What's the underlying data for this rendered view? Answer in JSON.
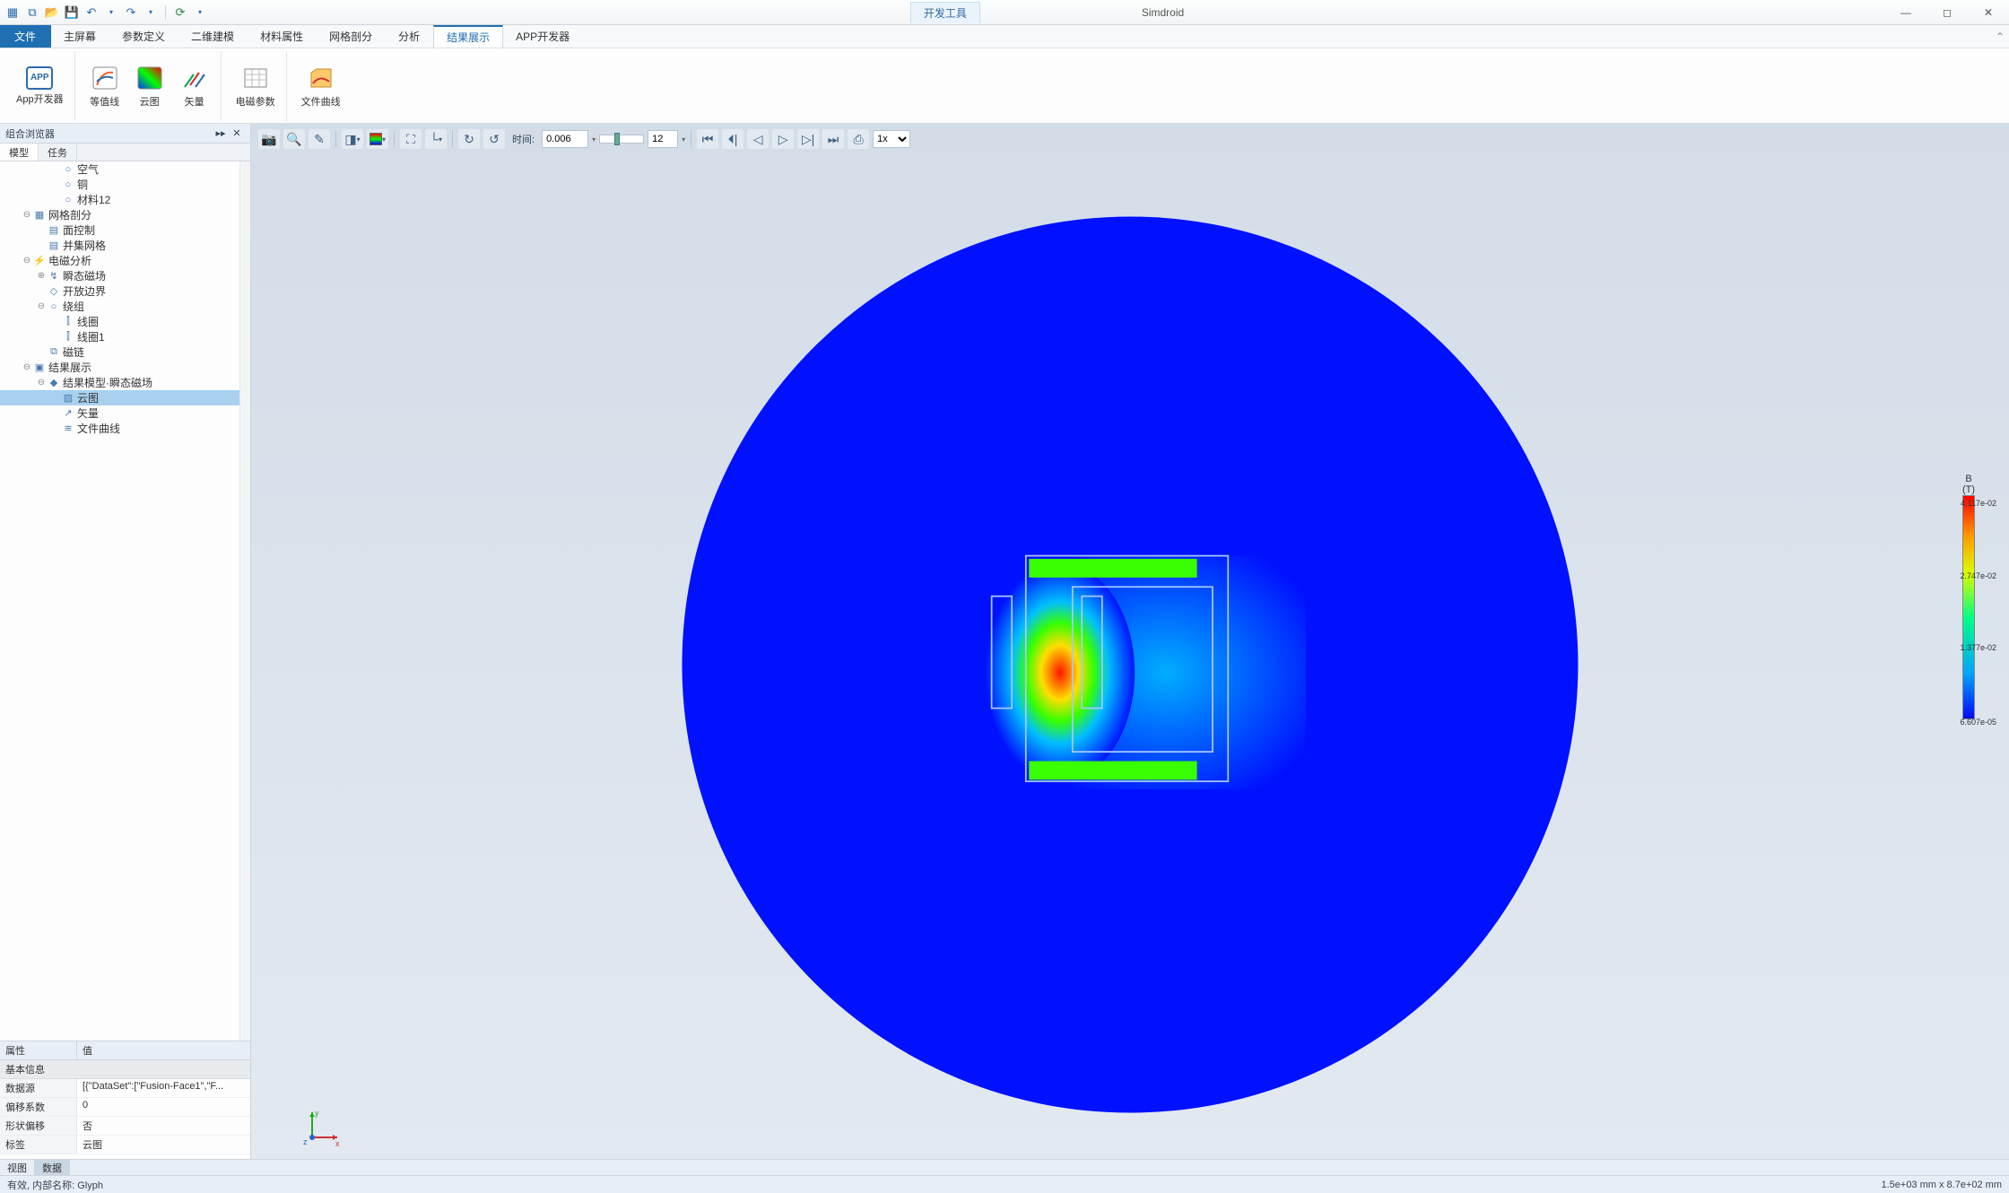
{
  "title": {
    "devtools": "开发工具",
    "app": "Simdroid"
  },
  "menu": {
    "file": "文件",
    "tabs": [
      "主屏幕",
      "参数定义",
      "二维建模",
      "材料属性",
      "网格剖分",
      "分析",
      "结果展示",
      "APP开发器"
    ],
    "active_index": 6
  },
  "ribbon": {
    "app_dev": "App开发器",
    "contour": "等值线",
    "cloud": "云图",
    "vector": "矢量",
    "em_param": "电磁参数",
    "file_curve": "文件曲线"
  },
  "browser": {
    "title": "组合浏览器",
    "tabs": [
      "模型",
      "任务"
    ],
    "active_tab": 0,
    "tree": [
      {
        "d": 3,
        "i": "○",
        "t": "空气"
      },
      {
        "d": 3,
        "i": "○",
        "t": "铜"
      },
      {
        "d": 3,
        "i": "○",
        "t": "材料12"
      },
      {
        "d": 1,
        "e": "⊖",
        "i": "▦",
        "t": "网格剖分"
      },
      {
        "d": 2,
        "i": "▤",
        "t": "面控制"
      },
      {
        "d": 2,
        "i": "▤",
        "t": "并集网格"
      },
      {
        "d": 1,
        "e": "⊖",
        "i": "⚡",
        "t": "电磁分析"
      },
      {
        "d": 2,
        "e": "⊕",
        "i": "↯",
        "t": "瞬态磁场"
      },
      {
        "d": 2,
        "i": "◇",
        "t": "开放边界"
      },
      {
        "d": 2,
        "e": "⊖",
        "i": "○",
        "t": "绕组"
      },
      {
        "d": 3,
        "i": "⫿",
        "t": "线圈"
      },
      {
        "d": 3,
        "i": "⫿",
        "t": "线圈1"
      },
      {
        "d": 2,
        "i": "⧉",
        "t": "磁链"
      },
      {
        "d": 1,
        "e": "⊖",
        "i": "▣",
        "t": "结果展示"
      },
      {
        "d": 2,
        "e": "⊖",
        "i": "◆",
        "t": "结果模型·瞬态磁场"
      },
      {
        "d": 3,
        "i": "▨",
        "t": "云图",
        "sel": true
      },
      {
        "d": 3,
        "i": "↗",
        "t": "矢量"
      },
      {
        "d": 3,
        "i": "≋",
        "t": "文件曲线"
      }
    ]
  },
  "props": {
    "hdr_attr": "属性",
    "hdr_val": "值",
    "section": "基本信息",
    "rows": [
      {
        "k": "数据源",
        "v": "[{\"DataSet\":[\"Fusion-Face1\",\"F..."
      },
      {
        "k": "偏移系数",
        "v": "0"
      },
      {
        "k": "形状偏移",
        "v": "否"
      },
      {
        "k": "标签",
        "v": "云图"
      }
    ]
  },
  "toolbar3d": {
    "time_label": "时间:",
    "time_value": "0.006",
    "frame_value": "12",
    "speed": "1x"
  },
  "legend": {
    "title1": "B",
    "title2": "(T)",
    "ticks": [
      {
        "p": 0,
        "v": "4.117e-02"
      },
      {
        "p": 33,
        "v": "2.747e-02"
      },
      {
        "p": 66,
        "v": "1.377e-02"
      },
      {
        "p": 100,
        "v": "6.607e-05"
      }
    ]
  },
  "bottom_tabs": [
    "视图",
    "数据"
  ],
  "bottom_active": 1,
  "status": {
    "left": "有效, 内部名称: Glyph",
    "right": "1.5e+03 mm x 8.7e+02 mm"
  },
  "axes": {
    "x": "x",
    "y": "y",
    "z": "z"
  },
  "chart_data": {
    "type": "heatmap",
    "title": "B (T)",
    "colormap": "jet",
    "value_range": [
      6.607e-05,
      0.04117
    ],
    "legend_ticks": [
      6.607e-05,
      0.01377,
      0.02747,
      0.04117
    ],
    "note": "2D circular domain with C-core electromagnet cross-section contour plot of magnetic flux density magnitude"
  }
}
